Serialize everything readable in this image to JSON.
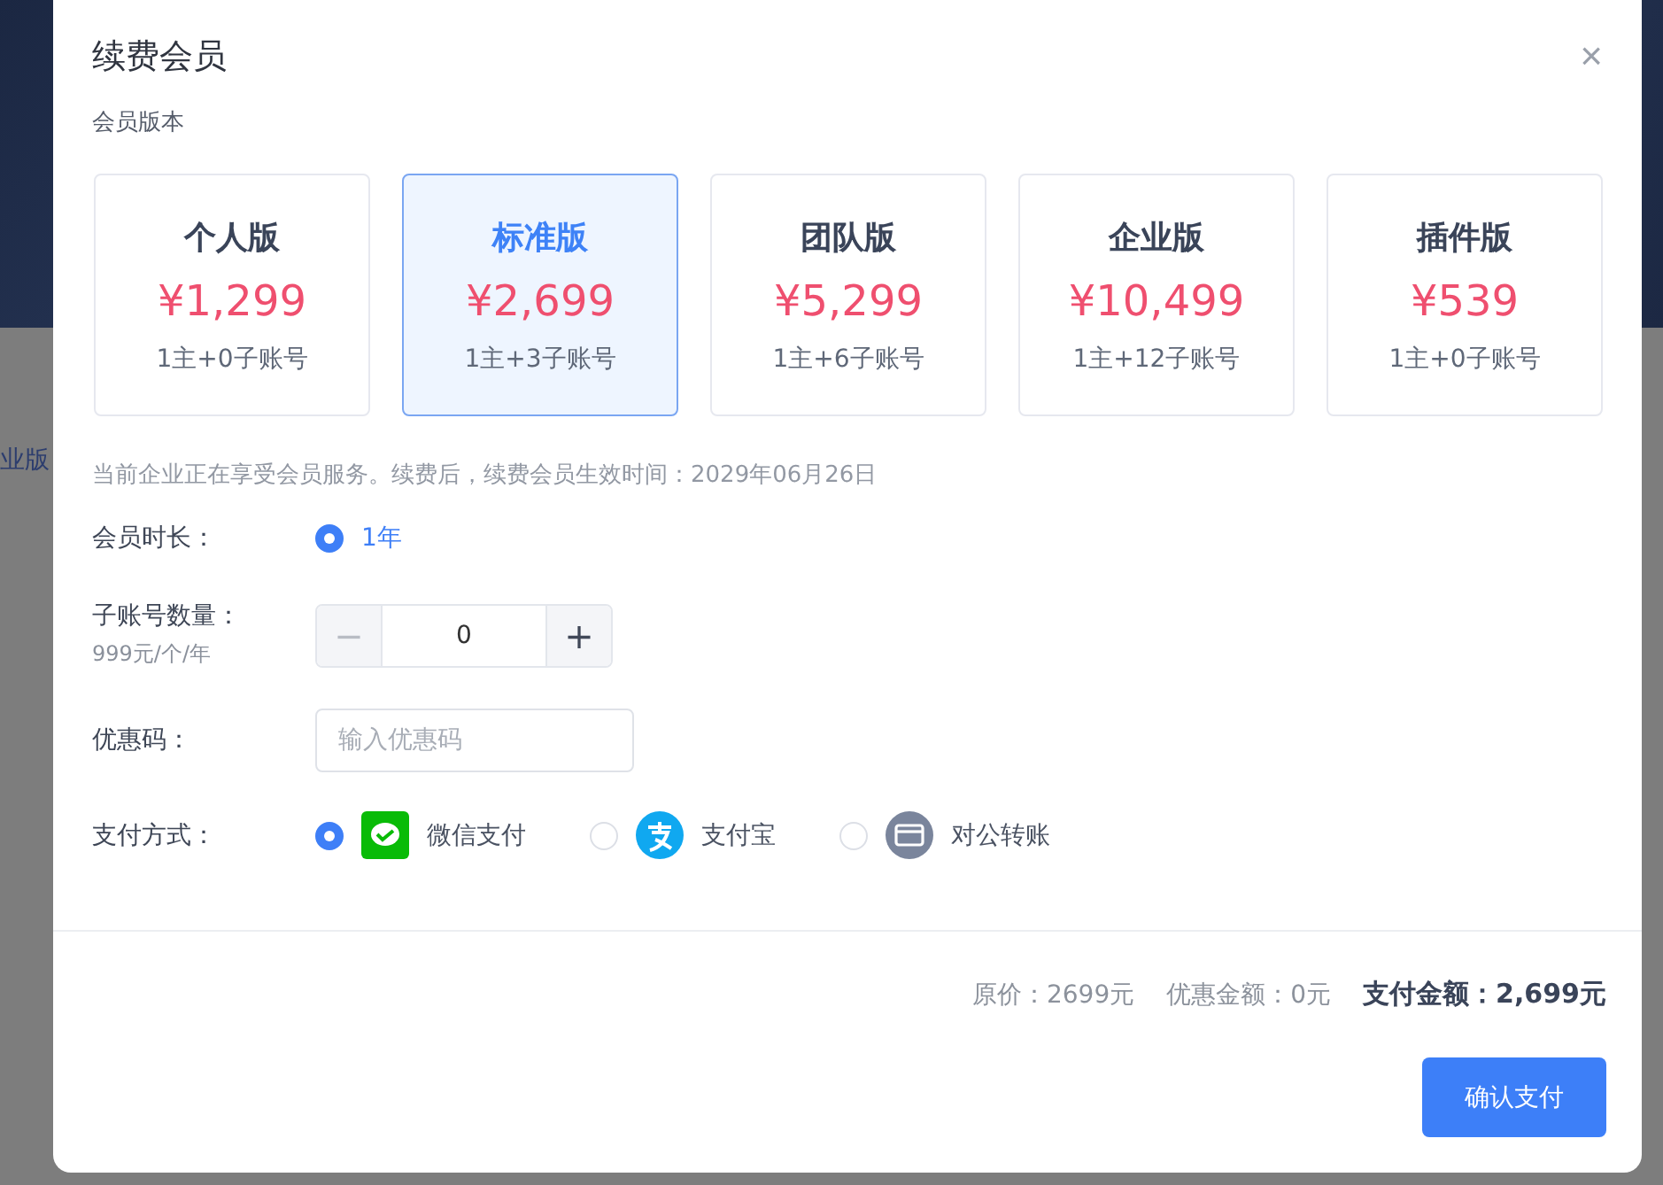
{
  "background": {
    "text": "业版"
  },
  "dialog": {
    "title": "续费会员",
    "close": "×"
  },
  "plans_label": "会员版本",
  "plans": [
    {
      "name": "个人版",
      "price": "¥1,299",
      "accounts": "1主+0子账号",
      "selected": false
    },
    {
      "name": "标准版",
      "price": "¥2,699",
      "accounts": "1主+3子账号",
      "selected": true
    },
    {
      "name": "团队版",
      "price": "¥5,299",
      "accounts": "1主+6子账号",
      "selected": false
    },
    {
      "name": "企业版",
      "price": "¥10,499",
      "accounts": "1主+12子账号",
      "selected": false
    },
    {
      "name": "插件版",
      "price": "¥539",
      "accounts": "1主+0子账号",
      "selected": false
    }
  ],
  "notice": "当前企业正在享受会员服务。续费后，续费会员生效时间：2029年06月26日",
  "duration": {
    "label": "会员时长：",
    "options": [
      {
        "label": "1年",
        "selected": true
      }
    ]
  },
  "sub_accounts": {
    "label": "子账号数量：",
    "hint": "999元/个/年",
    "minus": "−",
    "value": "0",
    "plus": "+"
  },
  "coupon": {
    "label": "优惠码：",
    "placeholder": "输入优惠码"
  },
  "payment": {
    "label": "支付方式：",
    "options": [
      {
        "kind": "wechat",
        "label": "微信支付",
        "selected": true
      },
      {
        "kind": "alipay",
        "label": "支付宝",
        "selected": false
      },
      {
        "kind": "transfer",
        "label": "对公转账",
        "selected": false
      }
    ]
  },
  "summary": {
    "original": "原价：2699元",
    "discount": "优惠金额：0元",
    "total": "支付金额：2,699元"
  },
  "confirm_button": "确认支付"
}
